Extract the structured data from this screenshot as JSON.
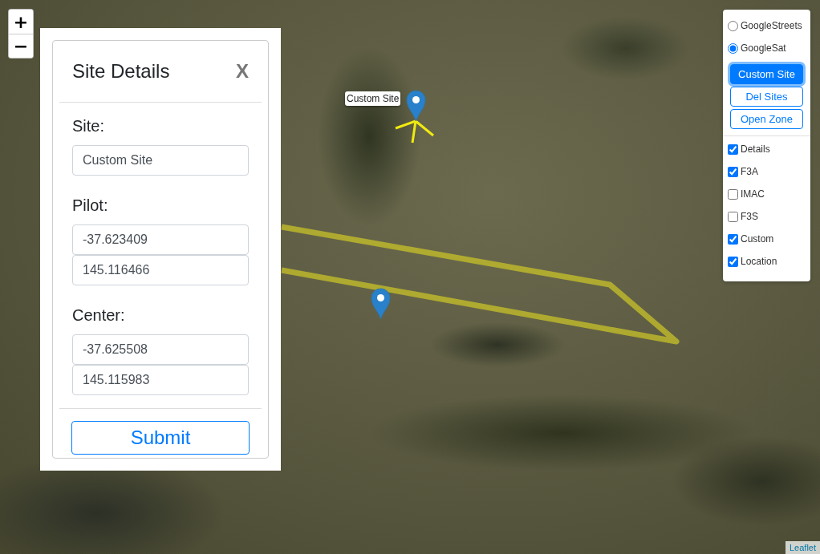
{
  "map": {
    "zoom_in": "+",
    "zoom_out": "−",
    "attribution": "Leaflet",
    "markers": [
      {
        "kind": "site",
        "label": "Custom Site"
      },
      {
        "kind": "center"
      }
    ]
  },
  "site_details": {
    "title": "Site Details",
    "close": "X",
    "sections": [
      {
        "label": "Site:",
        "fields": [
          "Custom Site"
        ]
      },
      {
        "label": "Pilot:",
        "fields": [
          "-37.623409",
          "145.116466"
        ]
      },
      {
        "label": "Center:",
        "fields": [
          "-37.625508",
          "145.115983"
        ]
      }
    ],
    "submit": "Submit"
  },
  "layers": {
    "base": [
      {
        "label": "GoogleStreets",
        "selected": false
      },
      {
        "label": "GoogleSat",
        "selected": true
      }
    ],
    "buttons": [
      {
        "label": "Custom Site",
        "selected": true
      },
      {
        "label": "Del Sites",
        "selected": false
      },
      {
        "label": "Open Zone",
        "selected": false
      }
    ],
    "overlays": [
      {
        "label": "Details",
        "checked": true
      },
      {
        "label": "F3A",
        "checked": true
      },
      {
        "label": "IMAC",
        "checked": false
      },
      {
        "label": "F3S",
        "checked": false
      },
      {
        "label": "Custom",
        "checked": true
      },
      {
        "label": "Location",
        "checked": true
      }
    ]
  }
}
